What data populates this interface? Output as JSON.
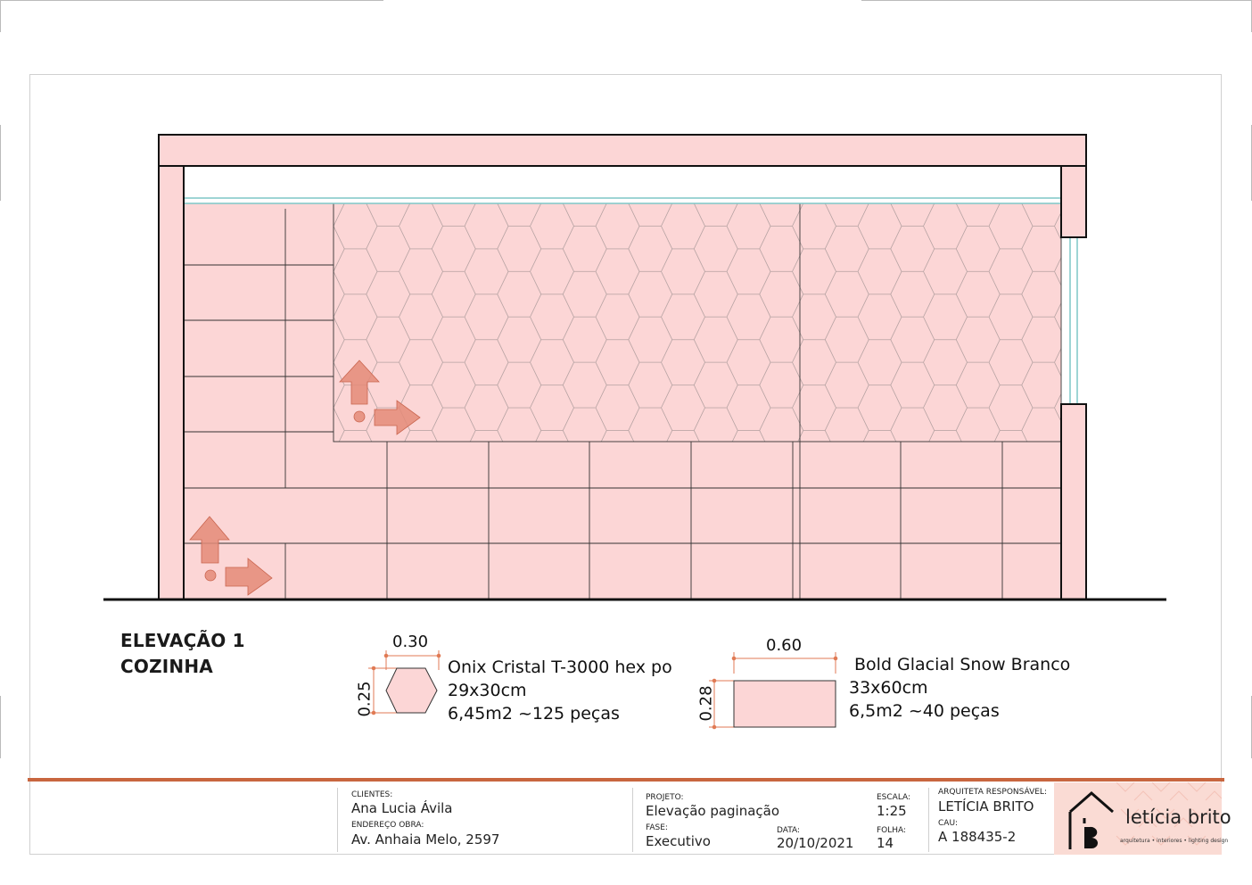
{
  "drawing": {
    "title_line1": "ELEVAÇÃO 1",
    "title_line2": "COZINHA",
    "tile_color": "#fcd6d6",
    "arrow_color": "#e48b78",
    "glass_color": "#7fc7c7"
  },
  "legend": {
    "hex": {
      "width_label": "0.30",
      "height_label": "0.25",
      "name": "Onix Cristal T-3000 hex po",
      "size": "29x30cm",
      "quantity": "6,45m2 ~125 peças"
    },
    "rect": {
      "width_label": "0.60",
      "height_label": "0.28",
      "name": "Bold Glacial Snow Branco",
      "size": "33x60cm",
      "quantity": "6,5m2 ~40 peças"
    }
  },
  "title_block": {
    "clientes_label": "CLIENTES:",
    "clientes_value": "Ana Lucia Ávila",
    "endereco_label": "ENDEREÇO OBRA:",
    "endereco_value": "Av. Anhaia Melo, 2597",
    "projeto_label": "PROJETO:",
    "projeto_value": "Elevação paginação",
    "fase_label": "FASE:",
    "fase_value": "Executivo",
    "data_label": "DATA:",
    "data_value": "20/10/2021",
    "escala_label": "ESCALA:",
    "escala_value": "1:25",
    "folha_label": "FOLHA:",
    "folha_value": "14",
    "arquiteta_label": "ARQUITETA RESPONSÁVEL:",
    "arquiteta_value": "LETÍCIA BRITO",
    "cau_label": "CAU:",
    "cau_value": "A 188435-2",
    "accent_color": "#c8663f"
  },
  "logo": {
    "name": "letícia brito",
    "tagline": "arquitetura • interiores • lighting design",
    "background": "#fadbd4"
  }
}
